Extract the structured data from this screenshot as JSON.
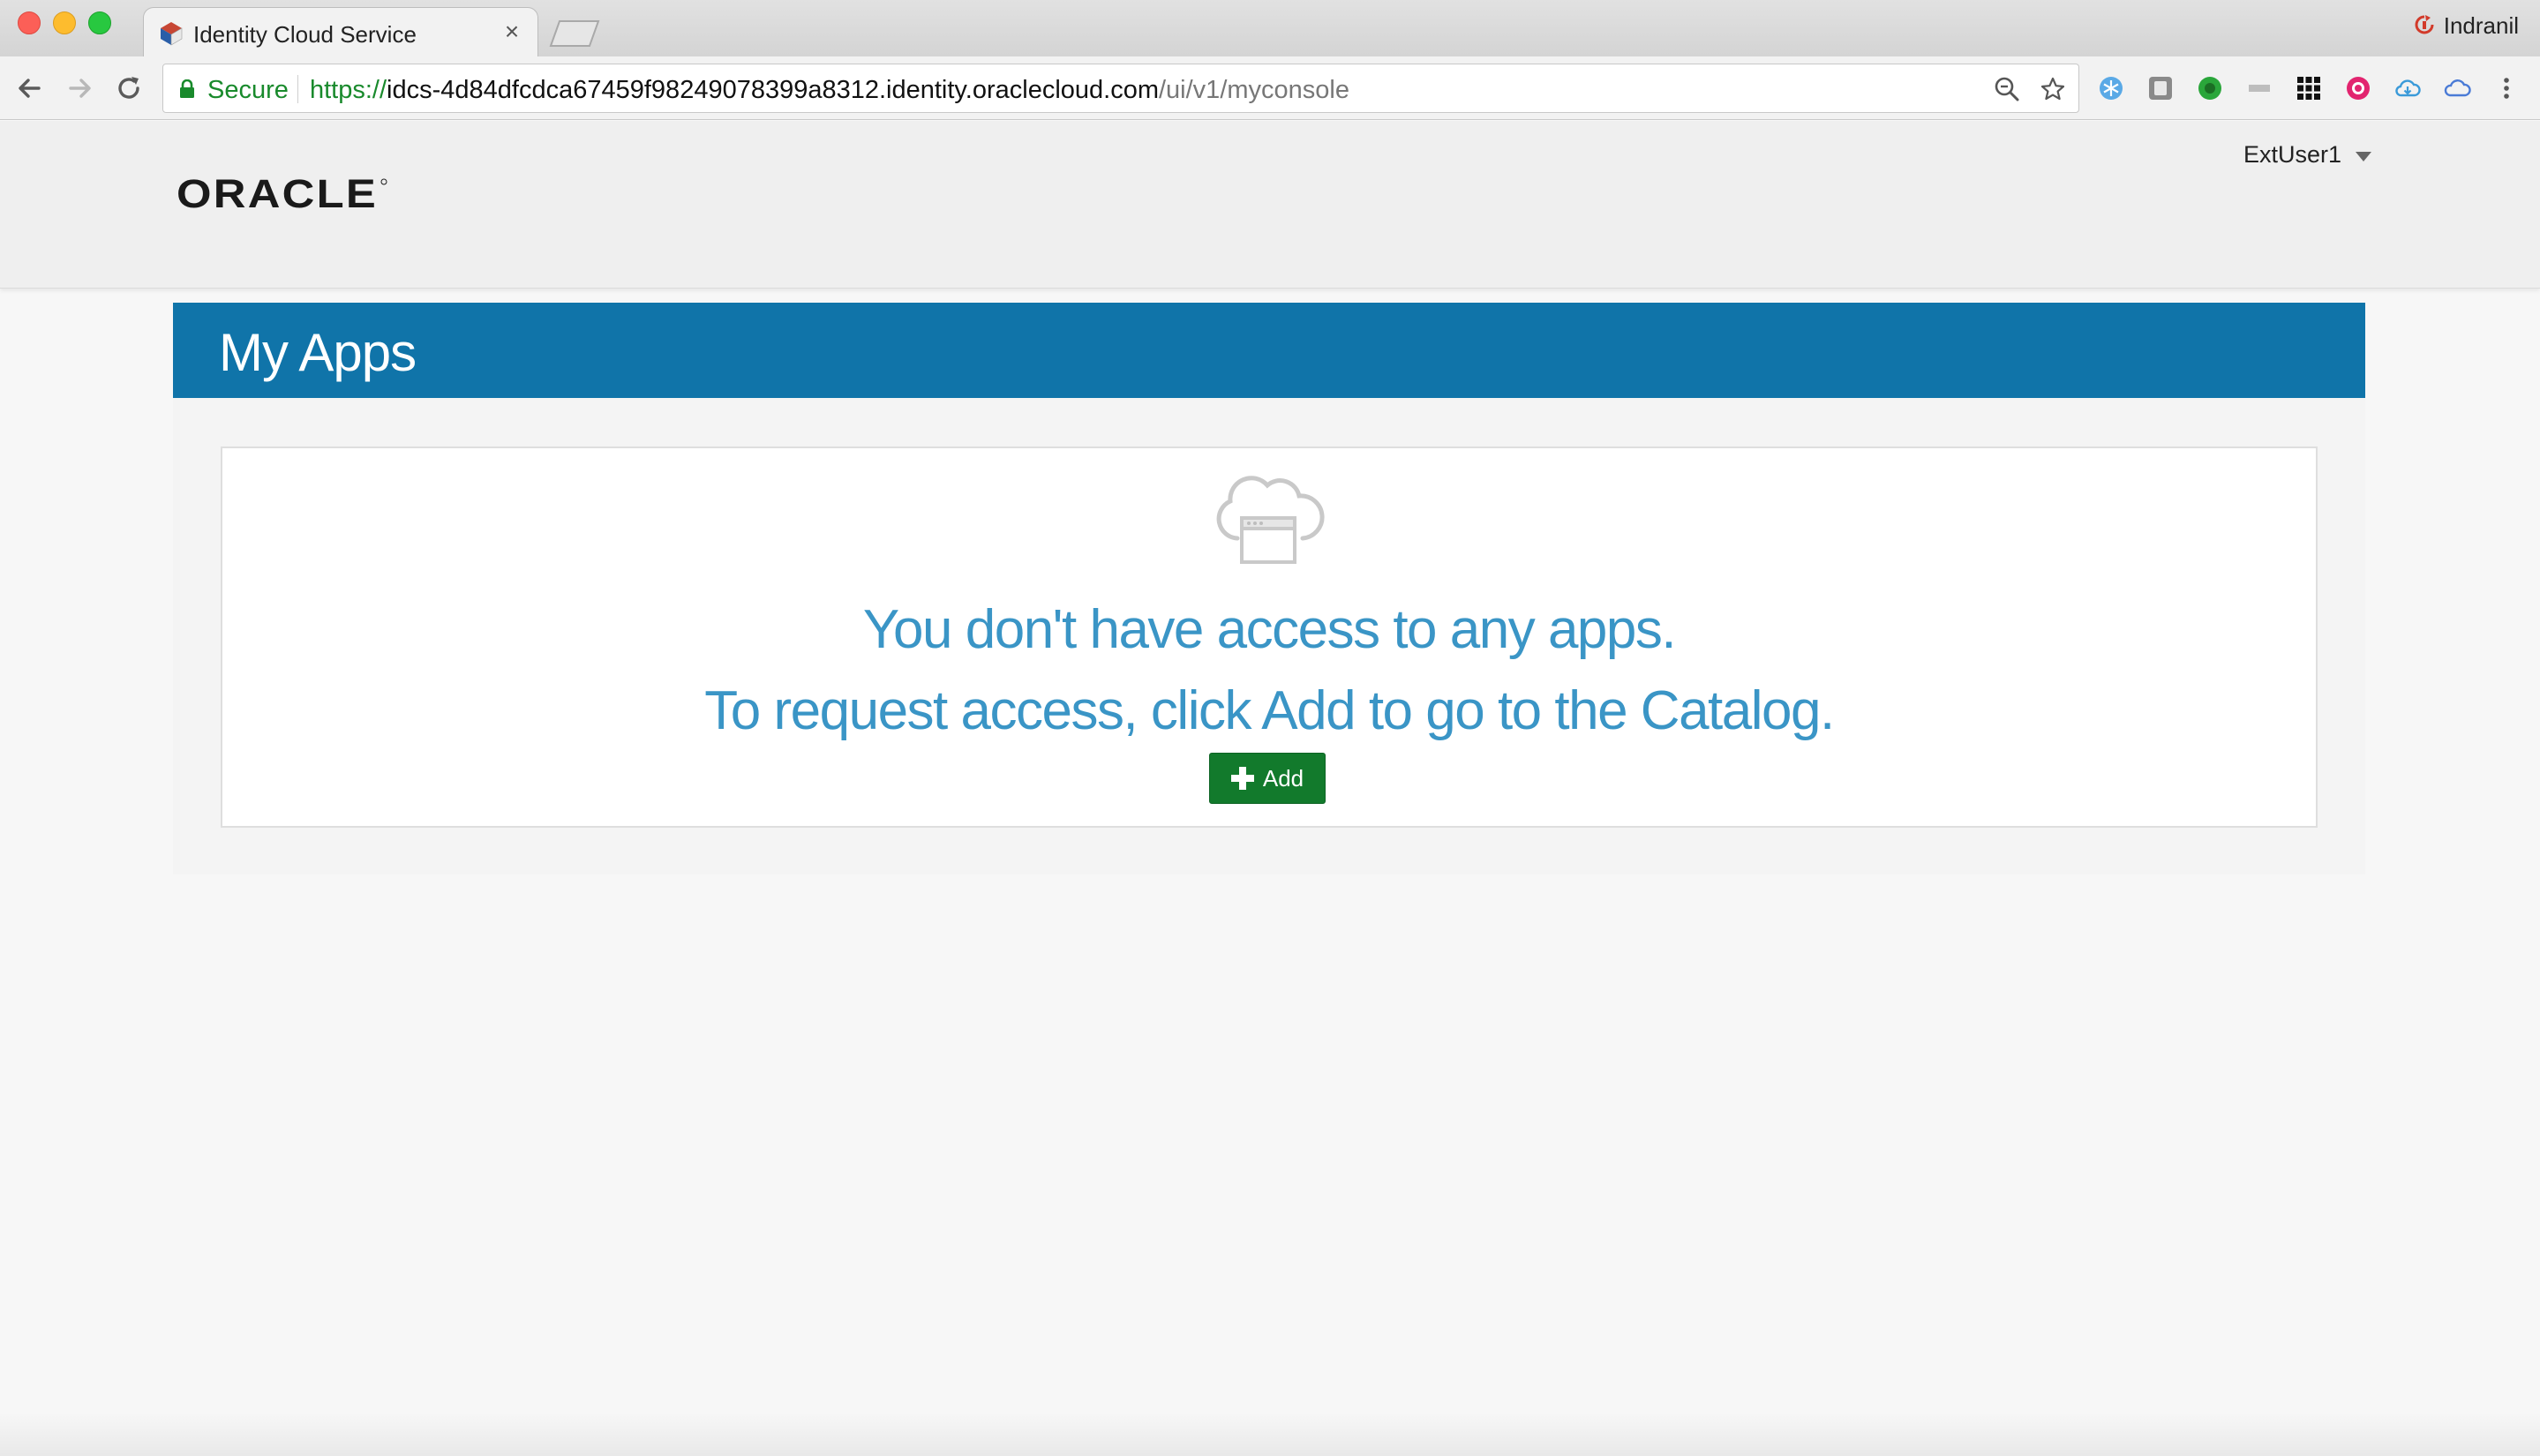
{
  "browser": {
    "tab_title": "Identity Cloud Service",
    "tab_close": "×",
    "profile_name": "Indranil",
    "secure_label": "Secure",
    "url_scheme": "https://",
    "url_host": "idcs-4d84dfcdca67459f98249078399a8312.identity.oraclecloud.com",
    "url_path": "/ui/v1/myconsole"
  },
  "header": {
    "logo_text": "ORACLE",
    "user_name": "ExtUser1"
  },
  "main": {
    "banner_title": "My Apps",
    "empty_message_line1": "You don't have access to any apps.",
    "empty_message_line2": "To request access, click Add to go to the Catalog.",
    "add_button_label": "Add"
  },
  "colors": {
    "banner": "#1074a9",
    "message": "#3a95c6",
    "add_button": "#127a2c",
    "secure": "#198a2c"
  }
}
